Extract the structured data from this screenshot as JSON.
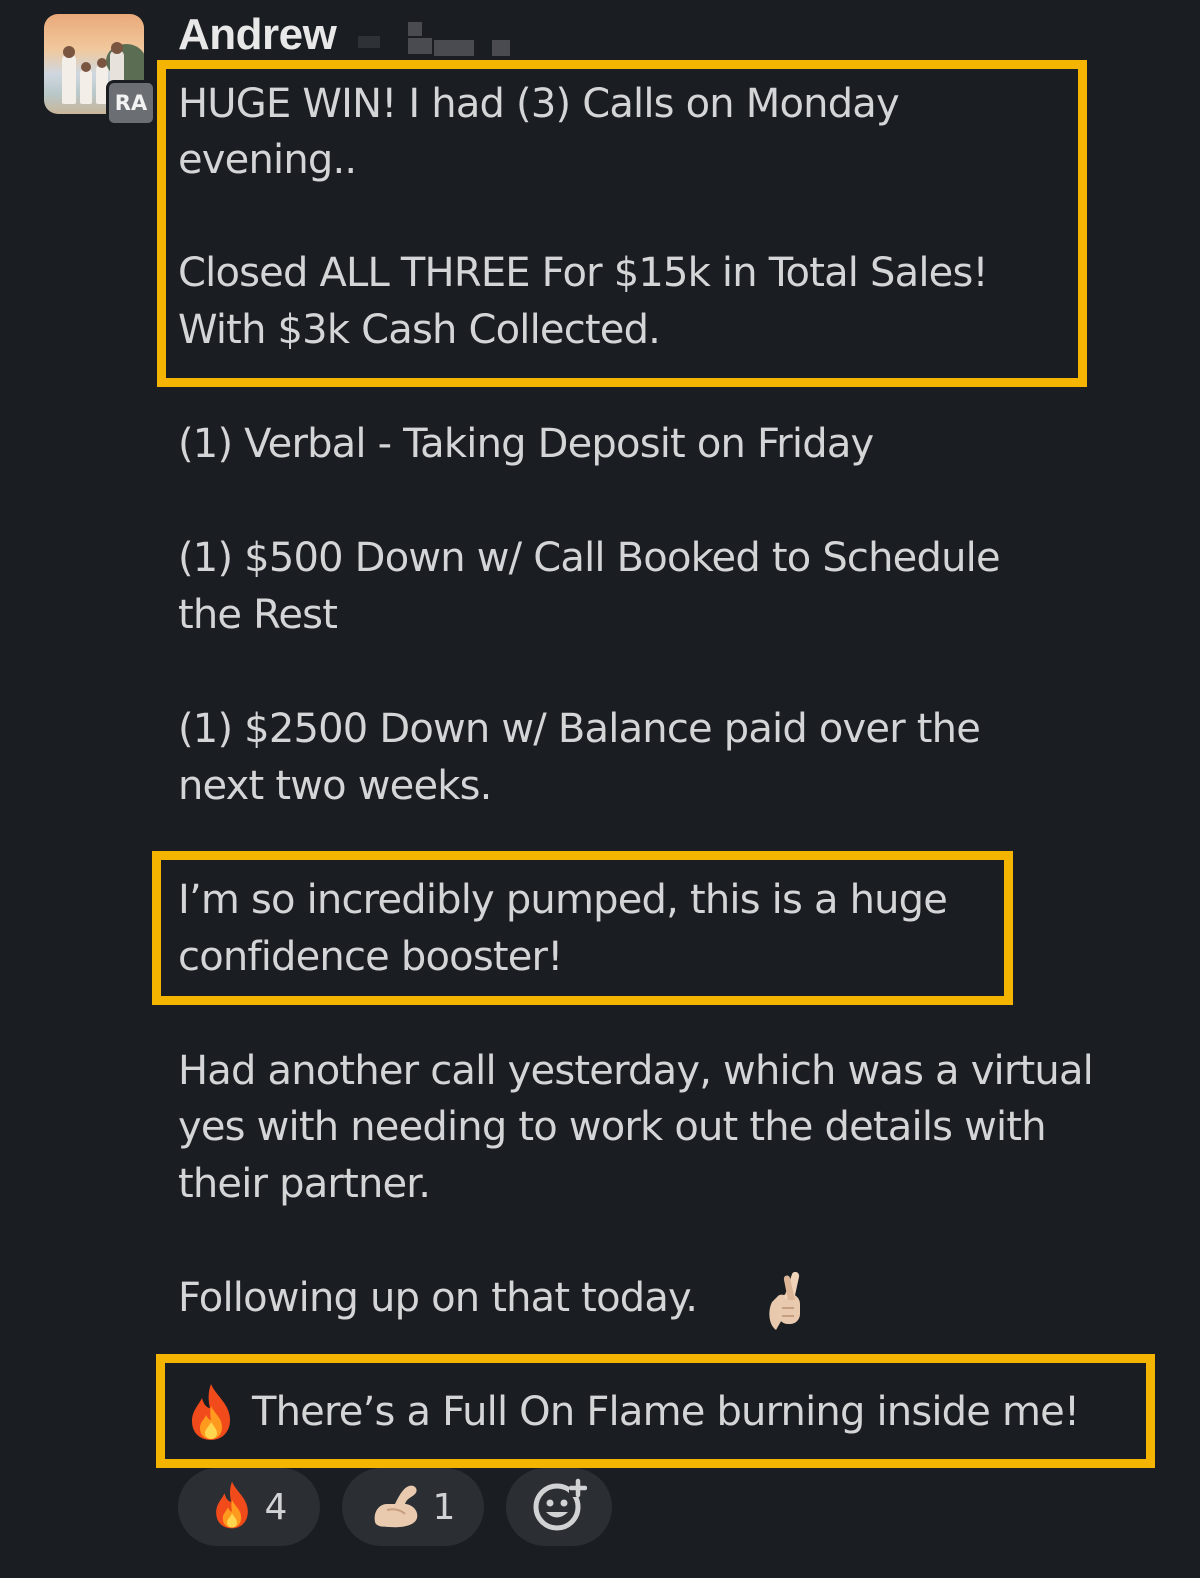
{
  "author": {
    "name": "Andrew",
    "badge": "RA"
  },
  "message": {
    "lines": [
      "HUGE WIN! I had (3) Calls on Monday",
      "evening..",
      "Closed ALL THREE For $15k in Total Sales!",
      "With $3k Cash Collected.",
      "(1) Verbal - Taking Deposit on Friday",
      "(1) $500 Down w/ Call Booked to Schedule",
      "the Rest",
      "(1) $2500 Down w/ Balance paid over the",
      "next two weeks.",
      "I’m so incredibly pumped, this is a huge",
      "confidence booster!",
      "Had another call yesterday, which was a virtual",
      "yes with needing to work out the details with",
      "their partner.",
      "Following up on that today.",
      "There’s a Full On Flame burning inside me!"
    ],
    "emojis": {
      "crossed_fingers": "crossed-fingers-icon",
      "fire": "fire-icon"
    }
  },
  "highlight_color": "#f5b400",
  "reactions": [
    {
      "icon": "fire-icon",
      "count": "4"
    },
    {
      "icon": "flexed-biceps-icon",
      "count": "1"
    },
    {
      "icon": "add-reaction-icon"
    }
  ]
}
